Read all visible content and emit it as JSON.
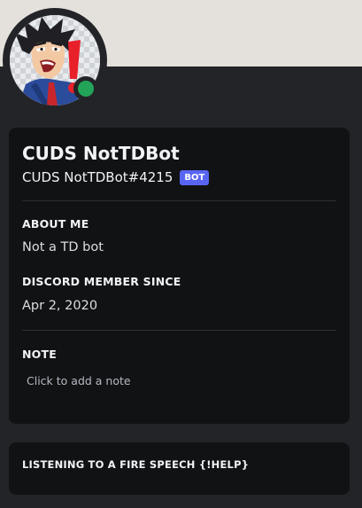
{
  "colors": {
    "banner": "#e4e0db",
    "background": "#232428",
    "card": "#111214",
    "status_online": "#23a559",
    "bot_tag": "#5865f2"
  },
  "profile": {
    "display_name": "CUDS NotTDBot",
    "username": "CUDS NotTDBot#4215",
    "bot_tag": "BOT",
    "status": "online"
  },
  "about": {
    "title": "ABOUT ME",
    "text": "Not a TD bot"
  },
  "member_since": {
    "title": "DISCORD MEMBER SINCE",
    "date": "Apr 2, 2020"
  },
  "note": {
    "title": "NOTE",
    "placeholder": "Click to add a note"
  },
  "activity": {
    "title": "LISTENING TO A FIRE SPEECH {!HELP}"
  }
}
